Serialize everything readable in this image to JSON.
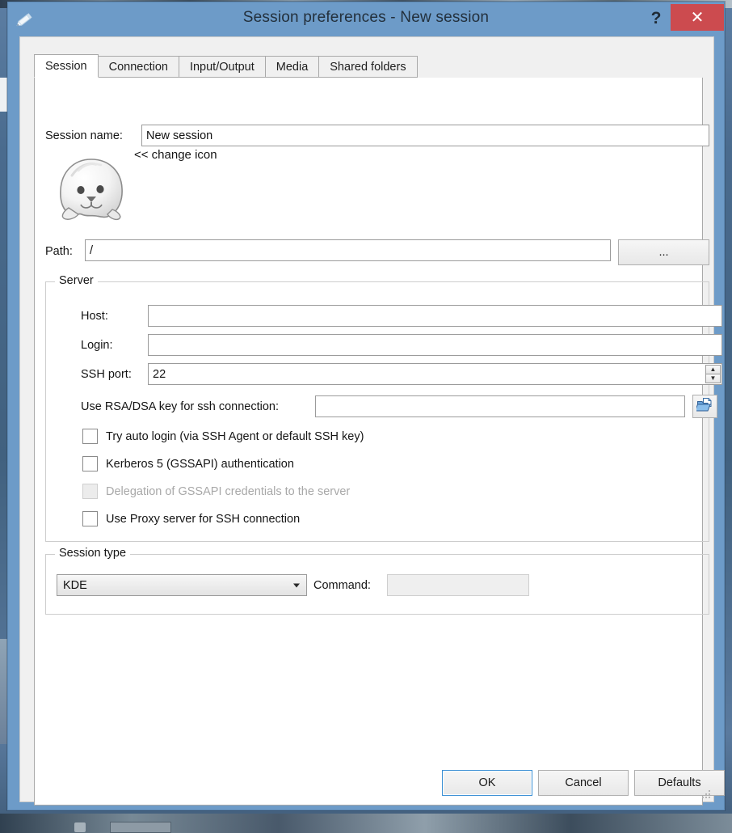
{
  "window": {
    "title": "Session preferences - New session",
    "title_icon": "pencil-icon",
    "help_label": "?",
    "close_label": "✕"
  },
  "tabs": [
    {
      "label": "Session",
      "active": true
    },
    {
      "label": "Connection",
      "active": false
    },
    {
      "label": "Input/Output",
      "active": false
    },
    {
      "label": "Media",
      "active": false
    },
    {
      "label": "Shared folders",
      "active": false
    }
  ],
  "session": {
    "name_label": "Session name:",
    "name_value": "New session",
    "icon_name": "seal-icon",
    "change_icon_label": "<< change icon",
    "path_label": "Path:",
    "path_value": "/",
    "path_browse_label": "..."
  },
  "server": {
    "group_title": "Server",
    "host_label": "Host:",
    "host_value": "",
    "login_label": "Login:",
    "login_value": "",
    "ssh_port_label": "SSH port:",
    "ssh_port_value": "22",
    "rsa_label": "Use RSA/DSA key for ssh connection:",
    "rsa_value": "",
    "rsa_browse_icon": "open-folder-icon",
    "checkboxes": [
      {
        "label": "Try auto login (via SSH Agent or default SSH key)",
        "checked": false,
        "disabled": false
      },
      {
        "label": "Kerberos 5 (GSSAPI) authentication",
        "checked": false,
        "disabled": false
      },
      {
        "label": "Delegation of GSSAPI credentials to the server",
        "checked": false,
        "disabled": true
      },
      {
        "label": "Use Proxy server for SSH connection",
        "checked": false,
        "disabled": false
      }
    ]
  },
  "session_type": {
    "group_title": "Session type",
    "selected": "KDE",
    "command_label": "Command:",
    "command_value": "",
    "command_disabled": true
  },
  "footer": {
    "ok_label": "OK",
    "cancel_label": "Cancel",
    "defaults_label": "Defaults"
  },
  "colors": {
    "titlebar": "#6d9bc8",
    "close_button": "#cc4b4f",
    "dialog_bg": "#f0f0f0",
    "page_bg": "#ffffff",
    "focus_border": "#3a8fd4"
  }
}
